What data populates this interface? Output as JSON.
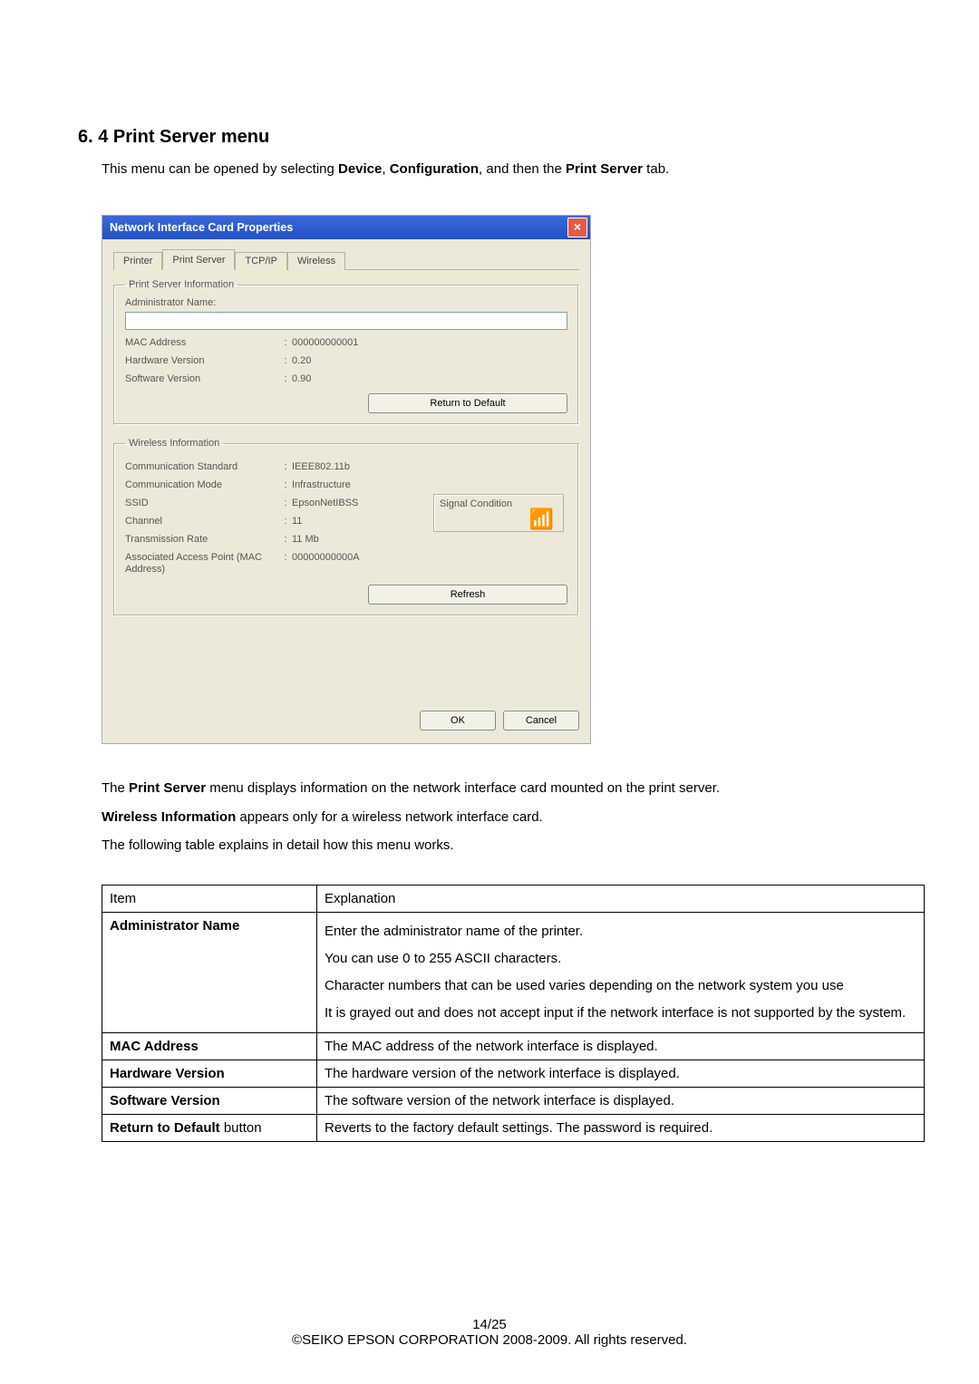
{
  "heading": "6. 4 Print Server menu",
  "intro": {
    "prefix": "This menu can be opened by selecting ",
    "bold1": "Device",
    "sep1": ", ",
    "bold2": "Configuration",
    "mid": ", and then the ",
    "bold3": "Print Server",
    "suffix": " tab."
  },
  "dialog": {
    "title": "Network Interface Card Properties",
    "close": "×",
    "tabs": [
      "Printer",
      "Print Server",
      "TCP/IP",
      "Wireless"
    ],
    "psinfo": {
      "legend": "Print Server Information",
      "admin_label": "Administrator Name:",
      "mac_label": "MAC Address",
      "mac_value": "000000000001",
      "hw_label": "Hardware Version",
      "hw_value": "0.20",
      "sw_label": "Software Version",
      "sw_value": "0.90",
      "return_btn": "Return to Default"
    },
    "wireless": {
      "legend": "Wireless Information",
      "std_label": "Communication Standard",
      "std_value": "IEEE802.11b",
      "mode_label": "Communication Mode",
      "mode_value": "Infrastructure",
      "ssid_label": "SSID",
      "ssid_value": "EpsonNetIBSS",
      "ch_label": "Channel",
      "ch_value": "11",
      "rate_label": "Transmission Rate",
      "rate_value": "11 Mb",
      "ap_label": "Associated Access Point (MAC Address)",
      "ap_value": "00000000000A",
      "signal_label": "Signal Condition",
      "refresh_btn": "Refresh"
    },
    "ok": "OK",
    "cancel": "Cancel"
  },
  "paras": {
    "p1_a": "The ",
    "p1_b": "Print Server",
    "p1_c": " menu displays information on the network interface card mounted on the print server.",
    "p2_a": "Wireless Information",
    "p2_b": " appears only for a wireless network interface card.",
    "p3": "The following table explains in detail how this menu works."
  },
  "table": {
    "h_item": "Item",
    "h_expl": "Explanation",
    "rows": [
      {
        "item_bold": "Administrator Name",
        "item_rest": "",
        "expl_lines": [
          "Enter the administrator name of the printer.",
          "You can use 0 to 255 ASCII characters.",
          "Character numbers that can be used varies depending on the network system you use",
          "It is grayed out and does not accept input if the network interface is not supported by the system."
        ]
      },
      {
        "item_bold": "MAC Address",
        "item_rest": "",
        "expl_lines": [
          "The MAC address of the network interface is displayed."
        ]
      },
      {
        "item_bold": "Hardware Version",
        "item_rest": "",
        "expl_lines": [
          "The hardware version of the network interface is displayed."
        ]
      },
      {
        "item_bold": "Software Version",
        "item_rest": "",
        "expl_lines": [
          "The software version of the network interface is displayed."
        ]
      },
      {
        "item_bold": "Return to Default",
        "item_rest": " button",
        "expl_lines": [
          "Reverts to the factory default settings. The password is required."
        ]
      }
    ]
  },
  "footer": {
    "pagenum": "14/25",
    "copyright": "©SEIKO EPSON CORPORATION 2008-2009. All rights reserved."
  }
}
